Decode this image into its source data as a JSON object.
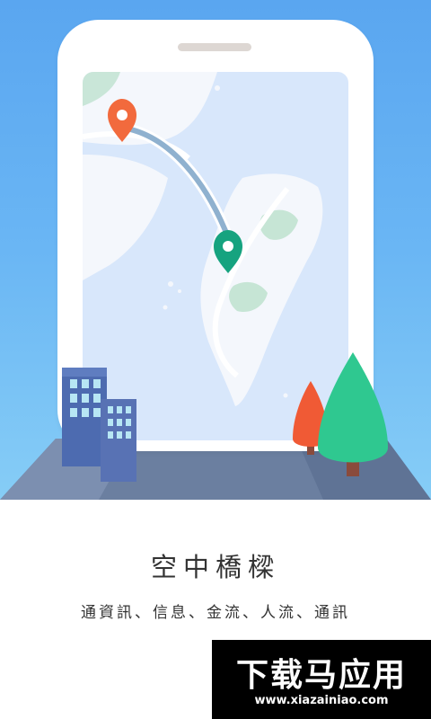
{
  "intro": {
    "title": "空中橋樑",
    "subtitle": "通資訊、信息、金流、人流、通訊"
  },
  "watermark": {
    "main": "下载马应用",
    "url": "www.xiazainiao.com"
  },
  "illustration": {
    "icons": [
      "origin-pin-icon",
      "destination-pin-icon",
      "building-icon",
      "tree-icon"
    ],
    "colors": {
      "sky": "#5aa6f0",
      "map": "#d8e7fb",
      "land": "#f5f8fd",
      "route": "#8fb1cf",
      "origin_pin": "#f26a3d",
      "destination_pin": "#16a37f",
      "tree": "#2fc890"
    }
  }
}
